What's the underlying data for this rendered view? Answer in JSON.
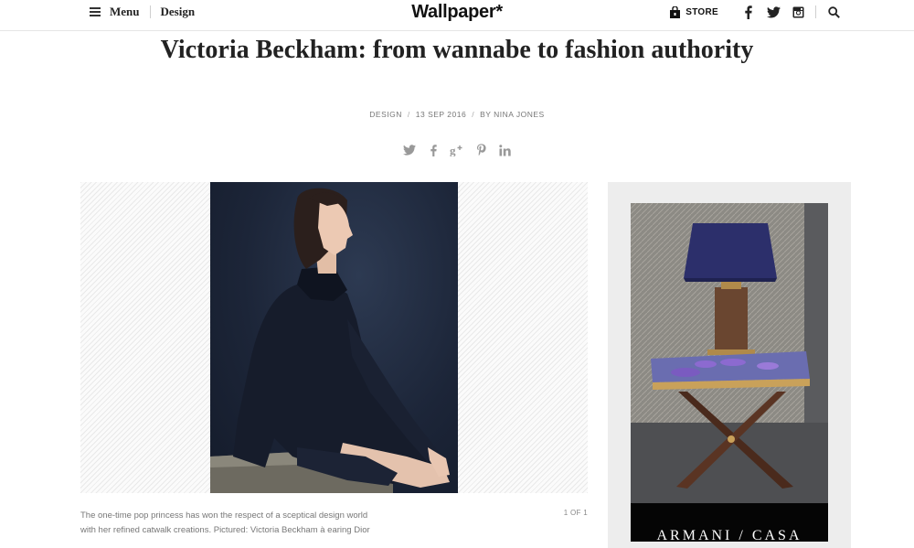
{
  "header": {
    "menu_label": "Menu",
    "category_label": "Design",
    "logo": "Wallpaper*",
    "store_label": "STORE",
    "icons": [
      "store-bag-icon",
      "facebook-icon",
      "twitter-icon",
      "instagram-icon",
      "search-icon"
    ]
  },
  "article": {
    "title": "Victoria Beckham: from wannabe to fashion authority",
    "category": "DESIGN",
    "date": "13 SEP 2016",
    "byline": "BY NINA JONES",
    "meta_separator": "/",
    "share_icons": [
      "twitter-icon",
      "facebook-icon",
      "google-plus-icon",
      "pinterest-icon",
      "linkedin-icon"
    ]
  },
  "gallery": {
    "caption": "The one-time pop princess has won the respect of a sceptical design world with her refined catwalk creations. Pictured: Victoria Beckham à earing Dior",
    "counter": "1 OF 1"
  },
  "advert": {
    "brand": "ARMANI / CASA"
  },
  "colors": {
    "text": "#222222",
    "meta": "#777777",
    "photo_background": "#1c2538",
    "ad_panel": "#ededed",
    "lamp_shade": "#2c2f6b",
    "coaster_purple": "#7a5bc0"
  }
}
